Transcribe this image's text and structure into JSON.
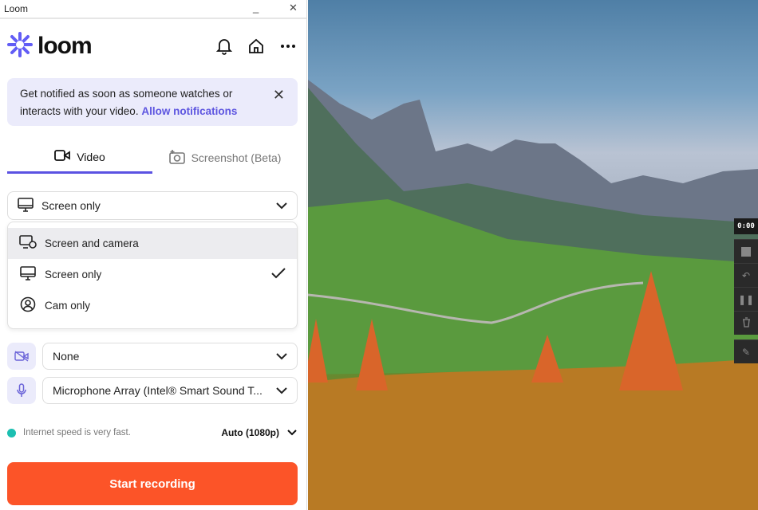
{
  "window": {
    "title": "Loom",
    "minimize": "_",
    "close": "✕"
  },
  "header": {
    "logo": "loom"
  },
  "banner": {
    "text": "Get notified as soon as someone watches or interacts with your video.",
    "link": "Allow notifications",
    "close": "✕"
  },
  "tabs": [
    {
      "label": "Video",
      "active": true
    },
    {
      "label": "Screenshot (Beta)",
      "active": false
    }
  ],
  "mode_select": {
    "value": "Screen only",
    "options": [
      {
        "label": "Screen and camera",
        "icon": "screen-camera-icon"
      },
      {
        "label": "Screen only",
        "icon": "monitor-icon",
        "selected": true
      },
      {
        "label": "Cam only",
        "icon": "user-circle-icon"
      }
    ]
  },
  "camera_select": {
    "value": "None",
    "icon": "camera-off-icon"
  },
  "mic_select": {
    "value": "Microphone Array (Intel® Smart Sound T...",
    "icon": "microphone-icon"
  },
  "status": {
    "speed": "Internet speed is very fast.",
    "quality": "Auto (1080p)",
    "dot_color": "#1cbfb1"
  },
  "start_button": {
    "label": "Start recording",
    "color": "#fc5428"
  },
  "recording_controls": {
    "timer": "0:00"
  },
  "accent": "#5b52e2"
}
